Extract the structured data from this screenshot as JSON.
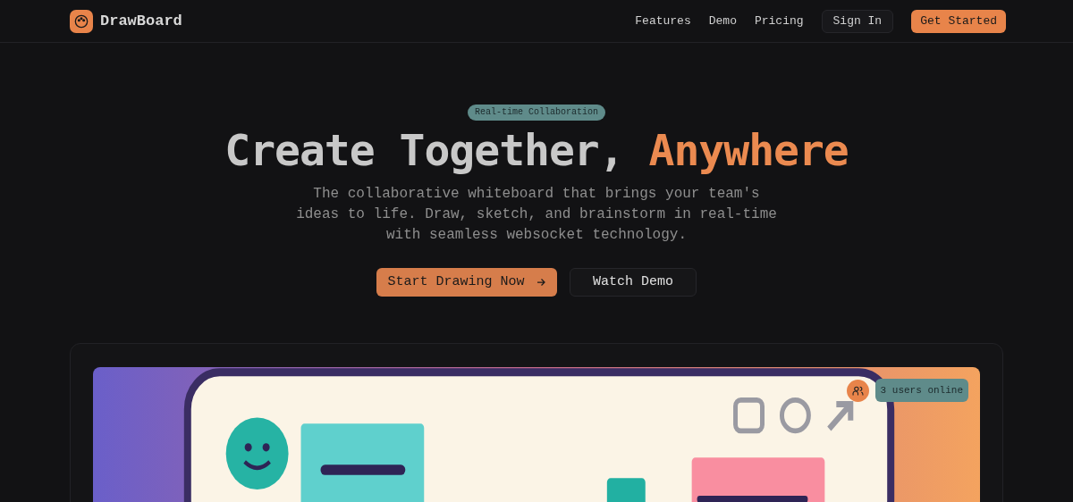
{
  "nav": {
    "brand": "DrawBoard",
    "links": [
      "Features",
      "Demo",
      "Pricing"
    ],
    "sign_in": "Sign In",
    "get_started": "Get Started"
  },
  "hero": {
    "badge": "Real-time Collaboration",
    "title": "Create Together,",
    "title_accent": "Anywhere",
    "description": "The collaborative whiteboard that brings your team's ideas to life. Draw, sketch, and brainstorm in real-time with seamless websocket technology.",
    "primary_button": "Start Drawing Now",
    "secondary_button": "Watch Demo"
  },
  "preview": {
    "kind": "picture",
    "online_badge": "3 users online"
  }
}
